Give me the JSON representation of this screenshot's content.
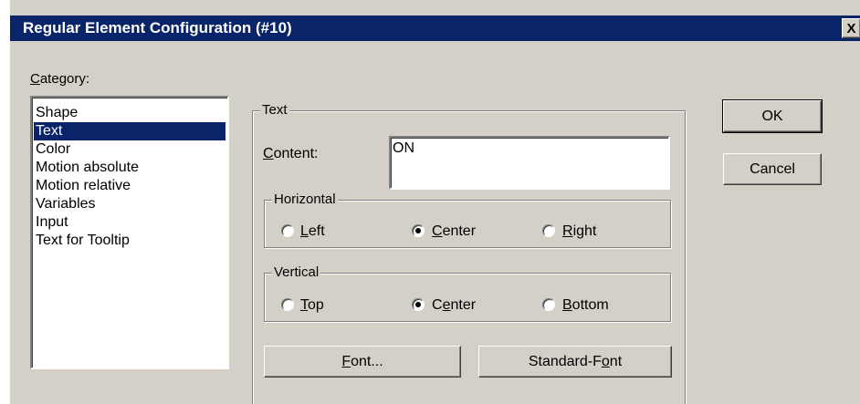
{
  "window": {
    "title": "Regular Element Configuration (#10)",
    "close_glyph": "X"
  },
  "category": {
    "label_hotkey": "C",
    "label_rest": "ategory:",
    "items": [
      {
        "label": "Shape",
        "selected": false
      },
      {
        "label": "Text",
        "selected": true
      },
      {
        "label": "Color",
        "selected": false
      },
      {
        "label": "Motion absolute",
        "selected": false
      },
      {
        "label": "Motion relative",
        "selected": false
      },
      {
        "label": "Variables",
        "selected": false
      },
      {
        "label": "Input",
        "selected": false
      },
      {
        "label": "Text for Tooltip",
        "selected": false
      }
    ]
  },
  "text_group": {
    "legend": "Text",
    "content_label_hotkey": "C",
    "content_label_rest": "ontent:",
    "content_value": "ON"
  },
  "horizontal": {
    "legend": "Horizontal",
    "options": [
      {
        "hotkey": "L",
        "rest": "eft",
        "pre": "",
        "checked": false
      },
      {
        "hotkey": "C",
        "rest": "enter",
        "pre": "",
        "checked": true
      },
      {
        "hotkey": "R",
        "rest": "ight",
        "pre": "",
        "checked": false
      }
    ]
  },
  "vertical": {
    "legend": "Vertical",
    "options": [
      {
        "hotkey": "T",
        "rest": "op",
        "pre": "",
        "checked": false
      },
      {
        "hotkey": "e",
        "rest": "nter",
        "pre": "C",
        "checked": true
      },
      {
        "hotkey": "B",
        "rest": "ottom",
        "pre": "",
        "checked": false
      }
    ]
  },
  "buttons": {
    "font_hotkey": "F",
    "font_rest": "ont...",
    "standard_font_pre": "Standard-F",
    "standard_font_hotkey": "o",
    "standard_font_rest": "nt",
    "ok": "OK",
    "cancel": "Cancel"
  },
  "colors": {
    "titlebar": "#0a246a",
    "face": "#d4d0c8",
    "selection": "#0a246a"
  }
}
